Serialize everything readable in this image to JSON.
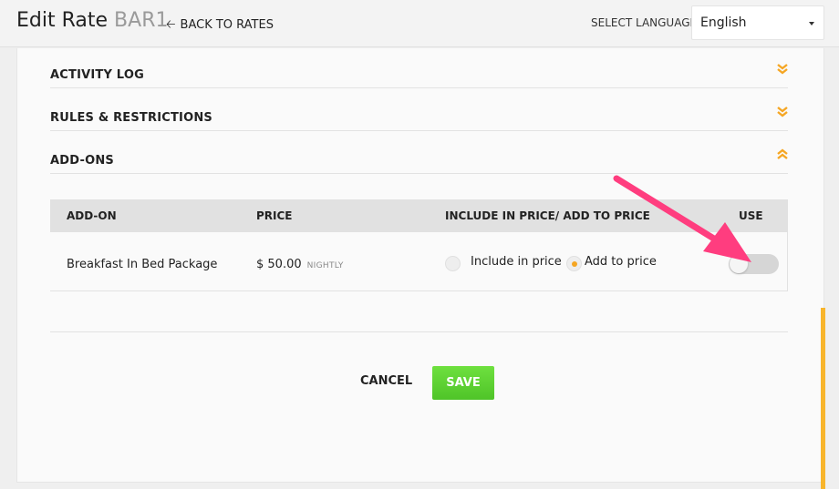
{
  "header": {
    "title": "Edit Rate",
    "rate_code": "BAR1",
    "back_label": "BACK TO RATES",
    "language_label": "SELECT LANGUAGE",
    "language_value": "English"
  },
  "sections": [
    {
      "title": "ACTIVITY LOG",
      "state": "collapsed"
    },
    {
      "title": "RULES & RESTRICTIONS",
      "state": "collapsed"
    },
    {
      "title": "ADD-ONS",
      "state": "expanded"
    }
  ],
  "addons_table": {
    "columns": [
      "ADD-ON",
      "PRICE",
      "INCLUDE IN PRICE/ ADD TO PRICE",
      "USE"
    ],
    "rows": [
      {
        "name": "Breakfast In Bed Package",
        "price": "$ 50.00",
        "price_unit": "NIGHTLY",
        "option_include": "Include in price",
        "option_add": "Add to price",
        "selected_option": "add",
        "use_enabled": false
      }
    ]
  },
  "actions": {
    "cancel_label": "CANCEL",
    "save_label": "SAVE"
  },
  "colors": {
    "accent": "#f5a623",
    "save_green": "#5bd032",
    "annotation_pink": "#ff3d7f",
    "scrollbar": "#f8b52c"
  }
}
